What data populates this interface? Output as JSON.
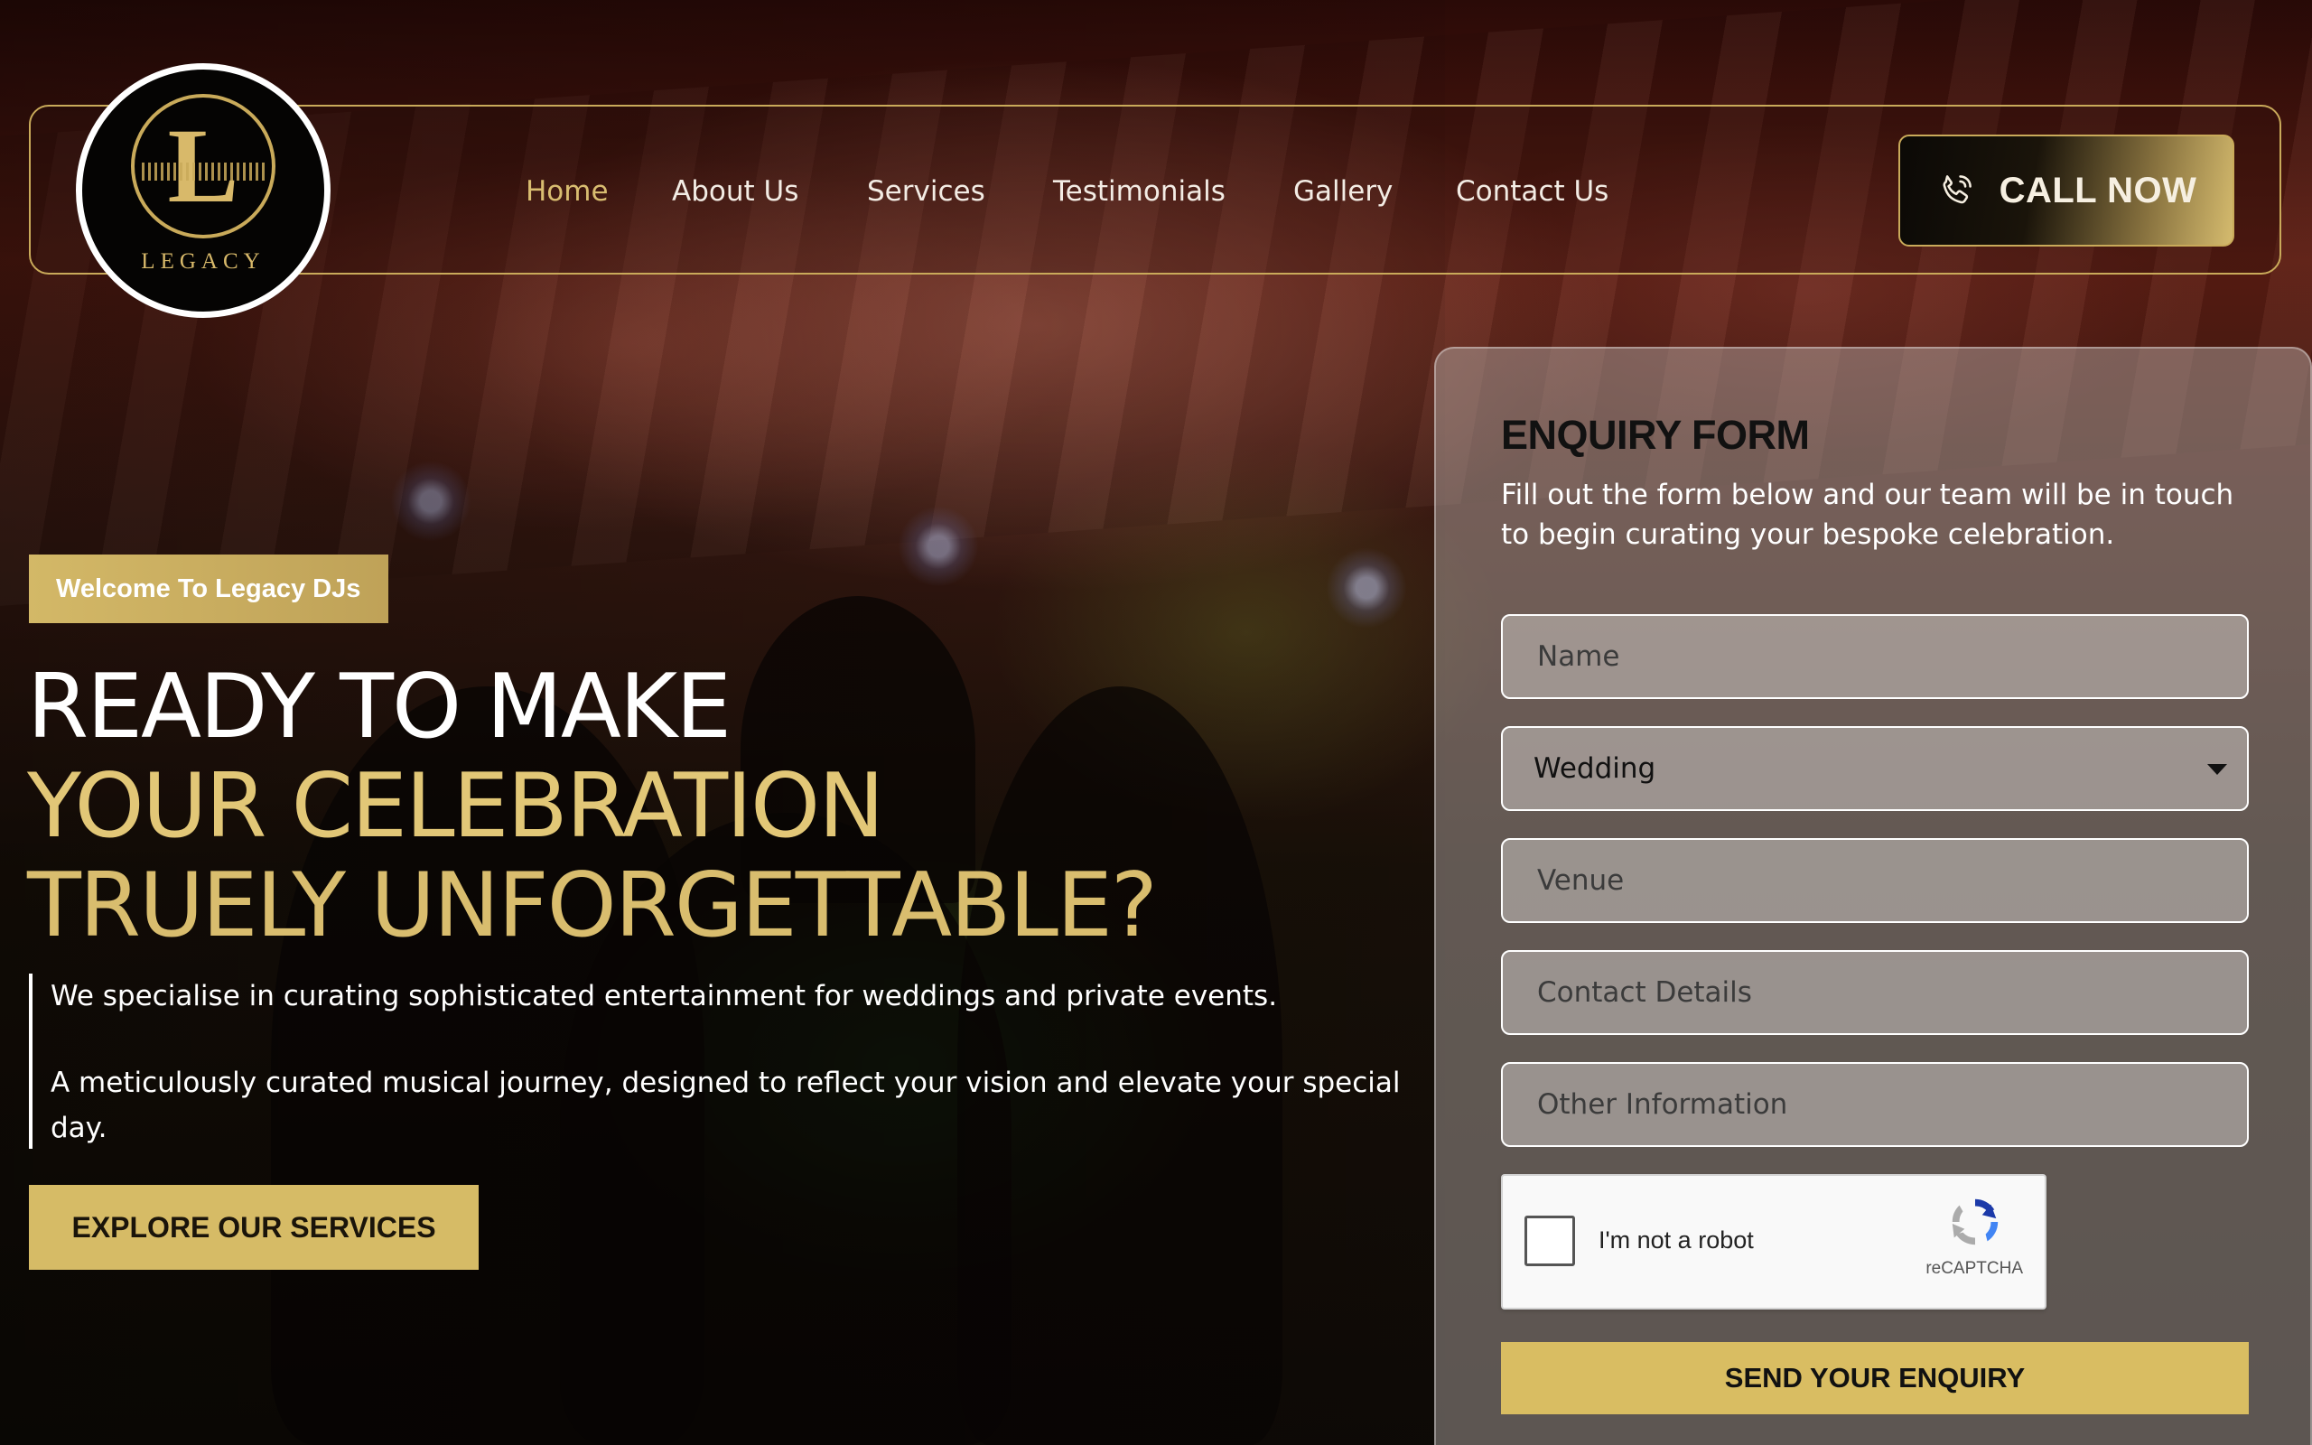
{
  "brand": {
    "logo_letter": "L",
    "logo_text": "LEGACY"
  },
  "nav": {
    "items": [
      {
        "label": "Home",
        "active": true
      },
      {
        "label": "About Us"
      },
      {
        "label": "Services"
      },
      {
        "label": "Testimonials"
      },
      {
        "label": "Gallery"
      },
      {
        "label": "Contact Us"
      }
    ]
  },
  "header": {
    "call_label": "CALL NOW",
    "call_icon": "phone-icon"
  },
  "hero": {
    "welcome": "Welcome To Legacy DJs",
    "headline_line1": "READY TO MAKE",
    "headline_line2": "YOUR CELEBRATION",
    "headline_line3": "TRUELY UNFORGETTABLE?",
    "paragraph1": "We specialise in curating sophisticated entertainment for weddings and private events.",
    "paragraph2": "A meticulously curated musical journey, designed to reflect your vision and elevate your special day.",
    "cta_label": "EXPLORE OUR SERVICES"
  },
  "form": {
    "title": "ENQUIRY FORM",
    "subtitle": "Fill out the form below and our team will be in touch to begin curating your bespoke celebration.",
    "name_placeholder": "Name",
    "event_type_value": "Wedding",
    "venue_placeholder": "Venue",
    "contact_placeholder": "Contact Details",
    "other_placeholder": "Other Information",
    "captcha_label": "I'm not a robot",
    "captcha_brand": "reCAPTCHA",
    "submit_label": "SEND YOUR ENQUIRY"
  },
  "colors": {
    "gold": "#d6bb66",
    "nav_active": "#d8bc70",
    "header_border": "#c9aa5a"
  }
}
